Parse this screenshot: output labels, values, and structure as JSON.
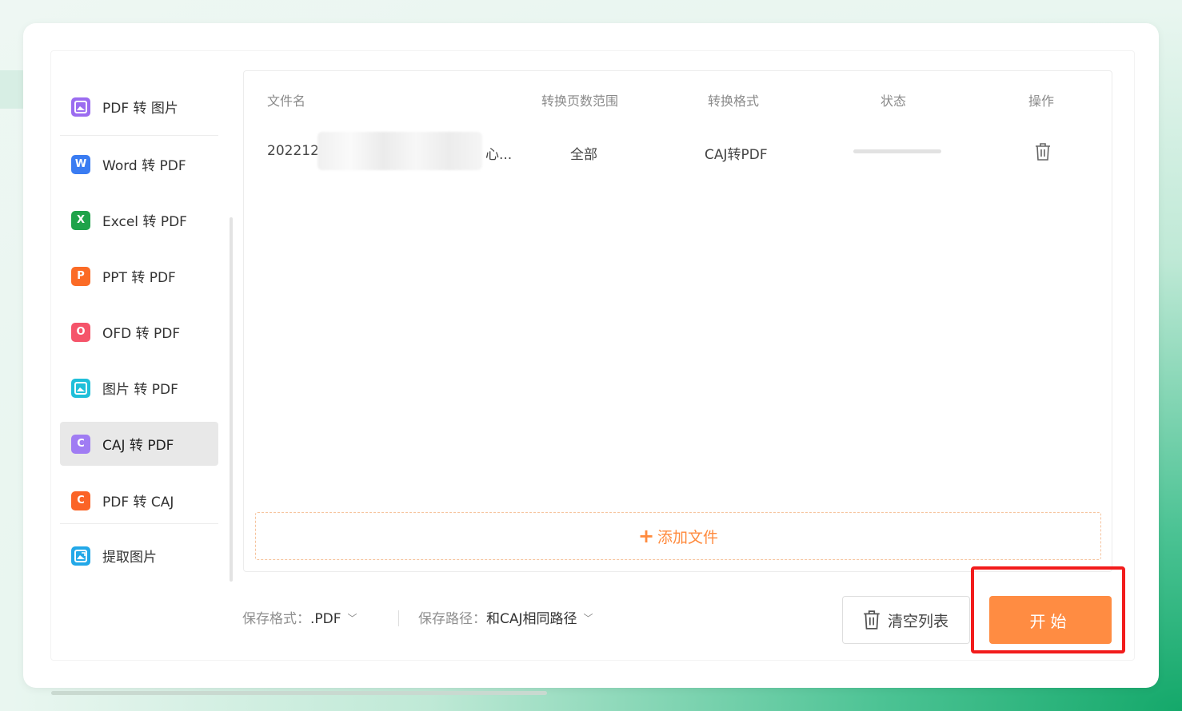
{
  "sidebar": {
    "items": [
      {
        "label": "PDF 转 图片",
        "icon": "pdf-to-image-icon",
        "color": "#9b6cf0",
        "glyph": "◪"
      },
      {
        "label": "Word 转 PDF",
        "icon": "word-icon",
        "color": "#3a7cf2",
        "glyph": "W"
      },
      {
        "label": "Excel 转 PDF",
        "icon": "excel-icon",
        "color": "#1fa34a",
        "glyph": "X"
      },
      {
        "label": "PPT 转 PDF",
        "icon": "ppt-icon",
        "color": "#fb6b26",
        "glyph": "P"
      },
      {
        "label": "OFD 转 PDF",
        "icon": "ofd-icon",
        "color": "#f5546a",
        "glyph": "O"
      },
      {
        "label": "图片 转 PDF",
        "icon": "image-to-pdf-icon",
        "color": "#1fbfd9",
        "glyph": "◩"
      },
      {
        "label": "CAJ 转 PDF",
        "icon": "caj-icon",
        "color": "#a07cf3",
        "glyph": "C"
      },
      {
        "label": "PDF 转 CAJ",
        "icon": "pdf-to-caj-icon",
        "color": "#fb6427",
        "glyph": "C"
      },
      {
        "label": "提取图片",
        "icon": "extract-image-icon",
        "color": "#22a8e8",
        "glyph": "◪"
      }
    ],
    "active_index": 6
  },
  "table": {
    "headers": {
      "filename": "文件名",
      "page_range": "转换页数范围",
      "format": "转换格式",
      "status": "状态",
      "action": "操作"
    },
    "rows": [
      {
        "filename_start": "202212",
        "filename_end": "心...",
        "page_range": "全部",
        "format": "CAJ转PDF"
      }
    ]
  },
  "add_file": {
    "plus": "+",
    "label": "添加文件"
  },
  "bottom": {
    "save_format_label": "保存格式：",
    "save_format_value": ".PDF",
    "save_path_label": "保存路径：",
    "save_path_value": "和CAJ相同路径",
    "chevron": "﹀",
    "clear_label": "清空列表",
    "start_label": "开始"
  },
  "colors": {
    "accent": "#ff8c42",
    "highlight": "#f21c1c"
  }
}
